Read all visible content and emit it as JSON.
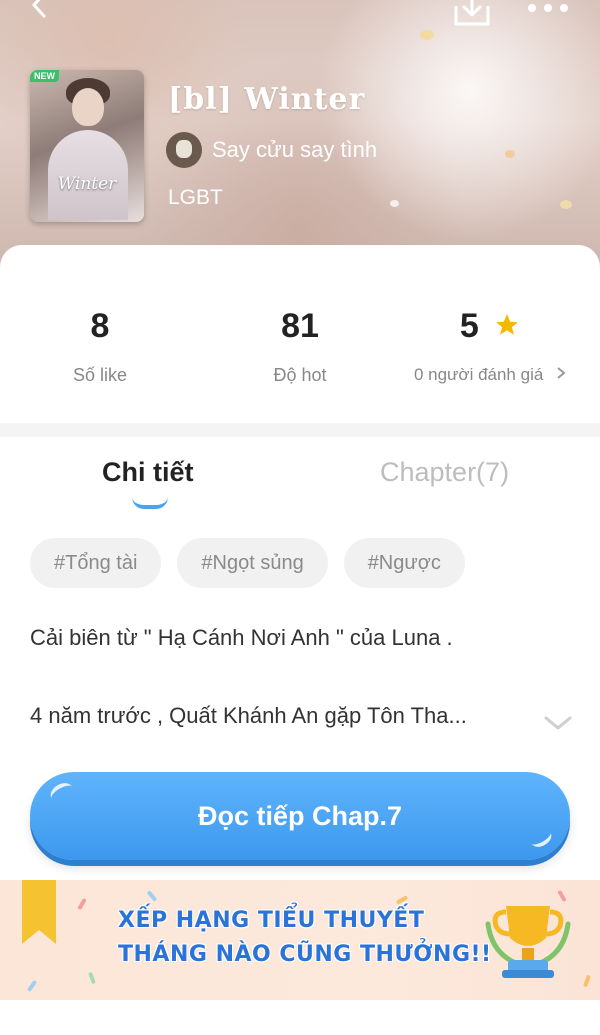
{
  "header": {
    "title": "[bl] Winter",
    "author": "Say cửu say tình",
    "genre": "LGBT",
    "cover": {
      "badge": "NEW",
      "title": "Winter"
    }
  },
  "stats": [
    {
      "value": "8",
      "label": "Số like"
    },
    {
      "value": "81",
      "label": "Độ hot"
    },
    {
      "value": "5",
      "label": "0 người đánh giá"
    }
  ],
  "tabs": {
    "detail": "Chi tiết",
    "chapter": "Chapter(7)"
  },
  "tags": [
    "#Tổng tài",
    "#Ngọt sủng",
    "#Ngược"
  ],
  "description": {
    "line1": "Cải biên từ \" Hạ Cánh Nơi Anh \" của Luna .",
    "line2": "4 năm trước , Quất Khánh An gặp Tôn Tha..."
  },
  "read_button": "Đọc tiếp Chap.7",
  "banner": {
    "line1": "XẾP HẠNG TIỂU THUYẾT",
    "line2": "THÁNG NÀO CŨNG THƯỞNG!!"
  },
  "colors": {
    "accent": "#4aa3f0",
    "star": "#f5b800",
    "banner_text": "#2a73d8",
    "new_badge": "#3bbf6a"
  },
  "icons": [
    "back-arrow-icon",
    "download-icon",
    "more-icon",
    "star-icon",
    "chevron-right-icon",
    "chevron-down-icon",
    "bookmark-icon",
    "trophy-icon"
  ]
}
